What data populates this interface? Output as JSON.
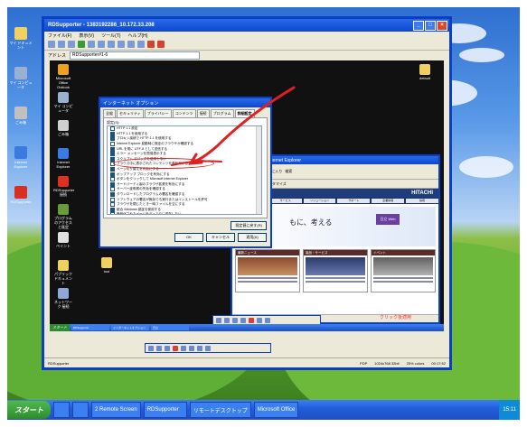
{
  "rd_window": {
    "title": "RDSupporter - 1383192286_10.172.33.208",
    "menu": [
      "ファイル(F)",
      "表示(V)",
      "ツール(T)",
      "ヘルプ(H)"
    ],
    "address_label": "アドレス",
    "address_value": "RDSupporter#1-6"
  },
  "desktop_icons": [
    {
      "label": "マイ ドキュメント",
      "color": "#f0d060"
    },
    {
      "label": "マイ コンピュータ",
      "color": "#9ab0d0"
    },
    {
      "label": "ごみ箱",
      "color": "#c0c0c0"
    },
    {
      "label": "Internet Explorer",
      "color": "#3c7ae0"
    },
    {
      "label": "RDSupporter",
      "color": "#d83020"
    }
  ],
  "remote_icons": [
    {
      "label": "Microsoft Office Outlook",
      "color": "#f0a020"
    },
    {
      "label": "マイ コンピュータ",
      "color": "#9ab0d0"
    },
    {
      "label": "ごみ箱",
      "color": "#d0d0d0"
    },
    {
      "label": "Internet Explorer",
      "color": "#3c7ae0"
    },
    {
      "label": "RDSupporter 接続",
      "color": "#e03020"
    },
    {
      "label": "プログラムのアクセスと既定",
      "color": "#6a9a3a"
    },
    {
      "label": "ペイント",
      "color": "#e0e0e0"
    },
    {
      "label": "パブリック ドキュメント",
      "color": "#f0d060"
    },
    {
      "label": "ネットワーク 接続",
      "color": "#8fa8d8"
    }
  ],
  "folder_icon_label": "tool",
  "top_right_folder_label": "default",
  "dialog": {
    "title": "インターネット オプション",
    "tabs": [
      "全般",
      "セキュリティ",
      "プライバシー",
      "コンテンツ",
      "接続",
      "プログラム",
      "詳細設定"
    ],
    "active_tab": 6,
    "settings_label": "設定(S):",
    "settings": [
      {
        "text": "HTTP 1.1 設定",
        "checked": false
      },
      {
        "text": "HTTP 1.1 を使用する",
        "checked": true
      },
      {
        "text": "プロキシ接続で HTTP 1.1 を使用する",
        "checked": true
      },
      {
        "text": "Internet Explorer 起動時に既定のブラウザか確認する",
        "checked": false
      },
      {
        "text": "URL を常に UTF-8 として送信する",
        "checked": true
      },
      {
        "text": "エラー メッセージを簡易表示する",
        "checked": true
      },
      {
        "text": "スクリプト デバッグを使用しない",
        "checked": true
      },
      {
        "text": "ブラウズ中に表示されたコンテンツを再利用する",
        "checked": false
      },
      {
        "text": "ページ切り替えを有効にする",
        "checked": true
      },
      {
        "text": "ポップアップ ブロックを有効にする",
        "checked": true
      },
      {
        "text": "ボタンをクリックして Microsoft Internet Explorer",
        "checked": false
      },
      {
        "text": "サードパーティ製のブラウザ拡張を有効にする",
        "checked": true
      },
      {
        "text": "サーバー証明書の失効を確認する",
        "checked": false
      },
      {
        "text": "ダウンロードしたプログラムの署名を確認する",
        "checked": true
      },
      {
        "text": "ソフトウェアの署名が無効でも実行またはインストールを許可",
        "checked": false
      },
      {
        "text": "ブラウザを閉じたとき一時ファイルを空にする",
        "checked": false
      },
      {
        "text": "統合 Windows 認証を使用する",
        "checked": true
      },
      {
        "text": "暗号化されたページをディスクに保存しない",
        "checked": false
      },
      {
        "text": "Microsoft 仮想マシンを使用する",
        "checked": false
      }
    ],
    "restore_button": "既定値に戻す(R)",
    "ok_button": "OK",
    "cancel_button": "キャンセル",
    "apply_button": "適用(A)"
  },
  "ie": {
    "title": "日立 - Microsoft Internet Explorer",
    "toolbar_items": [
      "戻る",
      "お気に入り",
      "検索"
    ],
    "linkbar_items": [
      "リンク",
      "Google",
      "カスタマイズ"
    ],
    "brand": "HITACHI",
    "nav_items": [
      "製品",
      "サービス",
      "ソリューション",
      "サポート",
      "企業情報",
      "採用"
    ],
    "hero_text": "もに、考える",
    "badge": "日立 Web",
    "news_boxes": [
      {
        "title": "最新ニュース"
      },
      {
        "title": "製品・サービス"
      },
      {
        "title": "イベント"
      }
    ],
    "status": "インターネット"
  },
  "red_note": "クリック後適用",
  "remote_taskbar": {
    "start": "スタート",
    "items": [
      "RDSupporter",
      "インターネットオプション",
      "日立"
    ]
  },
  "taskbar": {
    "start": "スタート",
    "items": [
      "2 Remote Screen",
      "RDSupporter",
      "リモートデスクトップ",
      "Microsoft Office"
    ],
    "clock": "15:11"
  },
  "status_bar": {
    "left": "RDSupporter",
    "items": [
      "PDP",
      "1024x768 32bit",
      "25% colors",
      "00:17:52"
    ]
  }
}
